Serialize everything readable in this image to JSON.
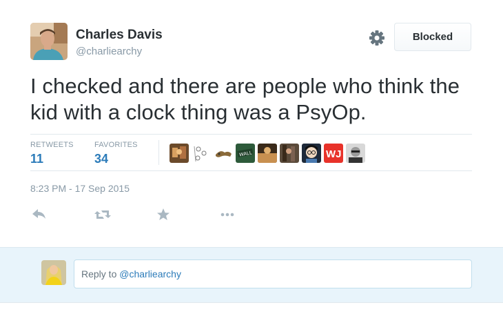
{
  "tweet": {
    "author": {
      "full_name": "Charles Davis",
      "username": "@charliearchy"
    },
    "text": "I checked and there are people who think the kid with a clock thing was a PsyOp.",
    "stats": {
      "retweets_label": "RETWEETS",
      "retweets_count": "11",
      "favorites_label": "FAVORITES",
      "favorites_count": "34"
    },
    "timestamp": "8:23 PM - 17 Sep 2015",
    "follow_button_label": "Blocked",
    "favoriter_avatars": [
      "avatar-1",
      "avatar-2",
      "avatar-3",
      "avatar-4",
      "avatar-5",
      "avatar-6",
      "avatar-7",
      "avatar-8",
      "avatar-9"
    ],
    "actions": [
      "reply-icon",
      "retweet-icon",
      "favorite-star-icon",
      "more-options-icon"
    ]
  },
  "reply": {
    "prefix": "Reply to ",
    "mention": "@charliearchy"
  },
  "colors": {
    "link_blue": "#2b7bb9",
    "muted_gray": "#8899a6",
    "text_dark": "#292f33",
    "reply_bg": "#e8f4fb"
  }
}
